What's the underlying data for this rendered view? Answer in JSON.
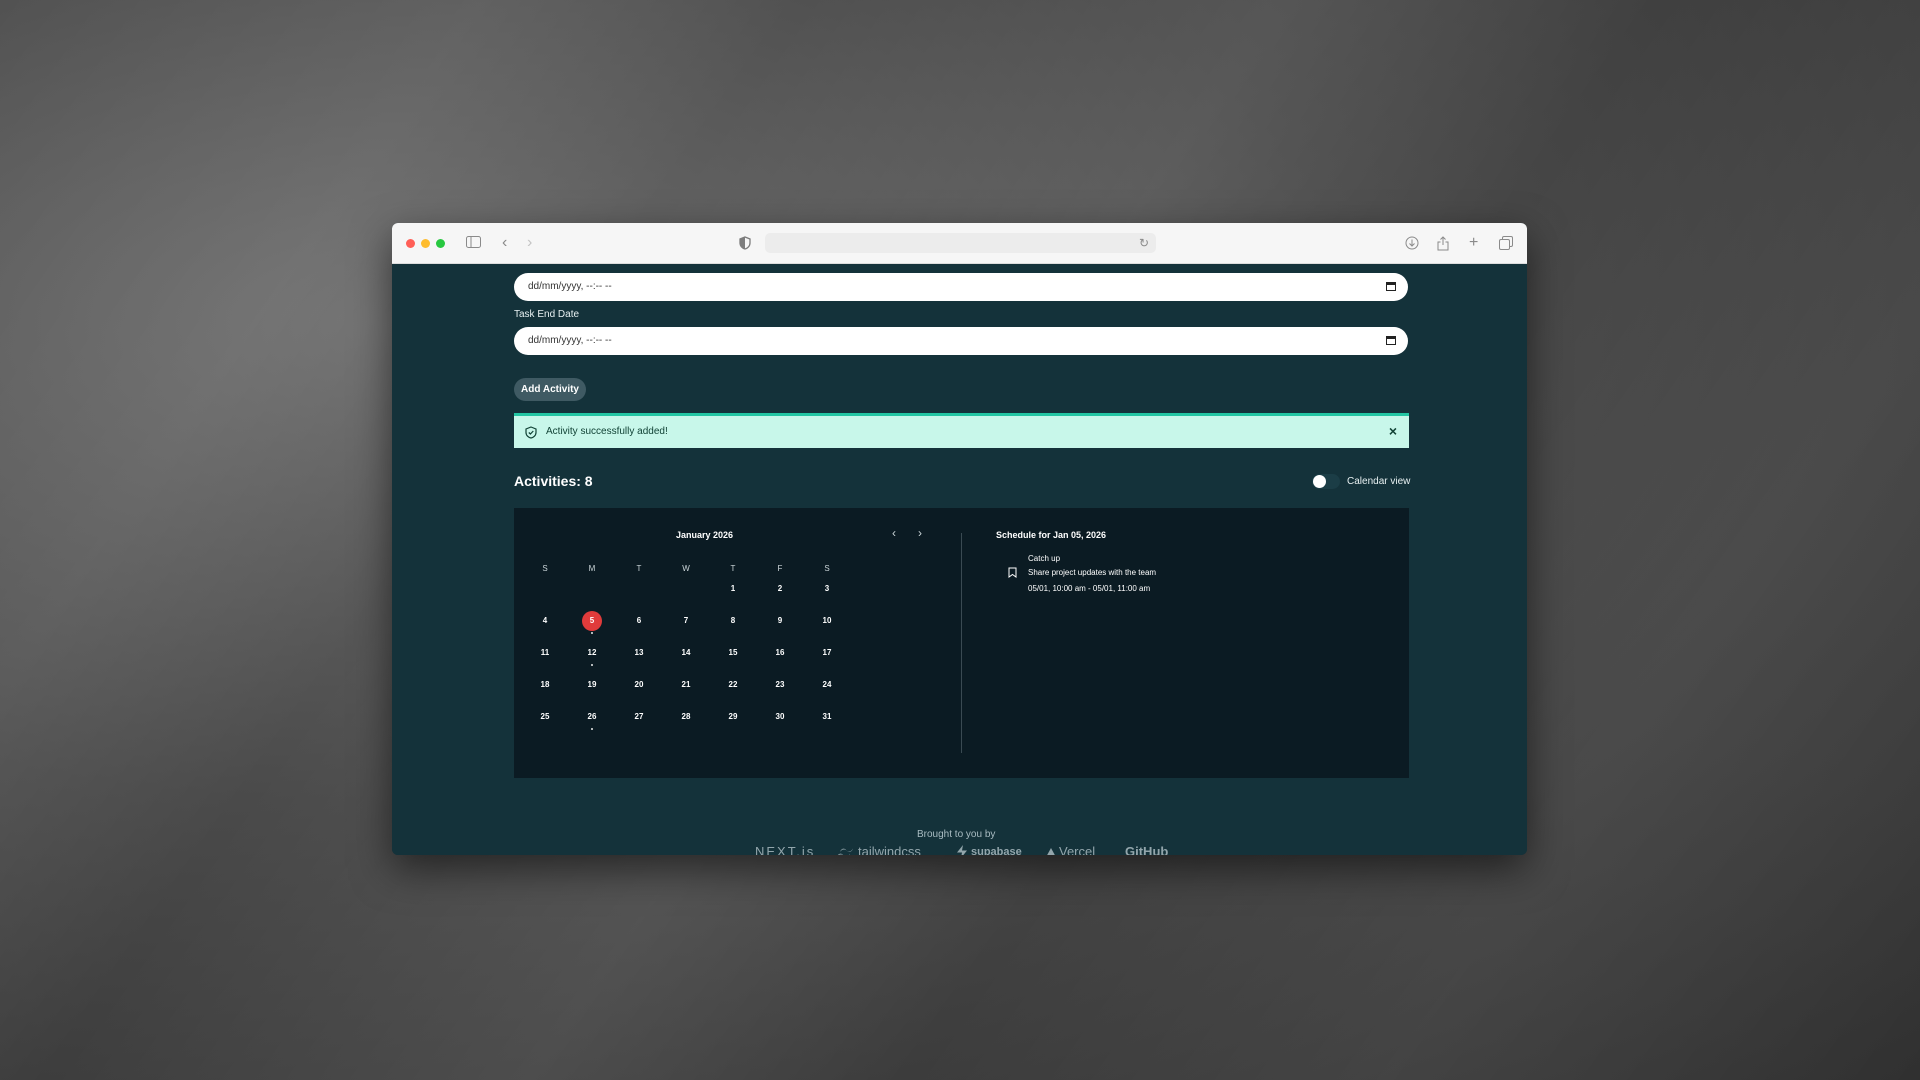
{
  "browser": {
    "url": "",
    "colors": {
      "close": "#ff5f57",
      "minimize": "#febc2e",
      "maximize": "#28c840"
    }
  },
  "form": {
    "start_date_placeholder": "dd/mm/yyyy, --:-- --",
    "end_date_label": "Task End Date",
    "end_date_placeholder": "dd/mm/yyyy, --:-- --",
    "add_button_label": "Add Activity"
  },
  "alert": {
    "message": "Activity successfully added!",
    "close_glyph": "×",
    "color": "#c8f7ea",
    "border_color": "#23c6a3"
  },
  "activities": {
    "heading": "Activities: 8",
    "toggle_label": "Calendar view",
    "toggle_on": false
  },
  "calendar": {
    "month_label": "January 2026",
    "prev_glyph": "‹",
    "next_glyph": "›",
    "weekdays": [
      "S",
      "M",
      "T",
      "W",
      "T",
      "F",
      "S"
    ],
    "days": [
      "1",
      "2",
      "3",
      "4",
      "5",
      "6",
      "7",
      "8",
      "9",
      "10",
      "11",
      "12",
      "13",
      "14",
      "15",
      "16",
      "17",
      "18",
      "19",
      "20",
      "21",
      "22",
      "23",
      "24",
      "25",
      "26",
      "27",
      "28",
      "29",
      "30",
      "31"
    ],
    "first_weekday_index": 4,
    "selected_day": "5",
    "selected_color": "#e03b3b",
    "marked_days": [
      "5",
      "12",
      "26"
    ]
  },
  "schedule": {
    "title": "Schedule for Jan 05, 2026",
    "items": [
      {
        "title": "Catch up",
        "description": "Share project updates with the team",
        "time": "05/01, 10:00 am - 05/01, 11:00 am"
      }
    ]
  },
  "footer": {
    "brought_by": "Brought to you by",
    "logos": [
      "NEXT.js",
      "tailwindcss",
      "supabase",
      "Vercel",
      "GitHub"
    ]
  }
}
